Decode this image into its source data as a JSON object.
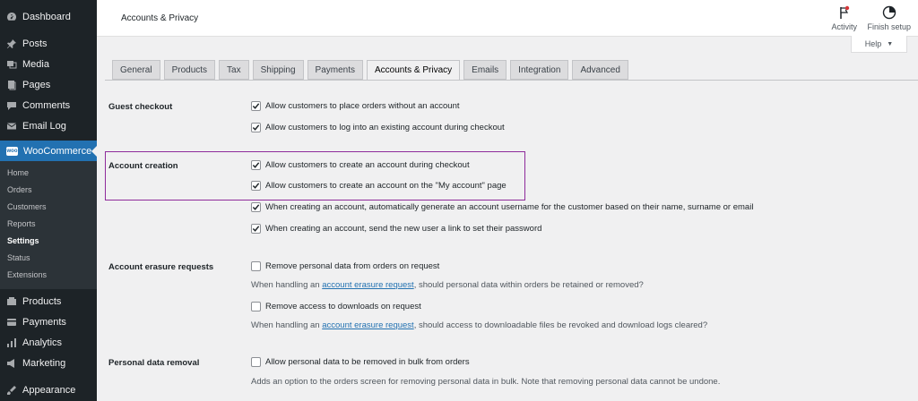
{
  "sidebar": {
    "top_items": [
      {
        "label": "Dashboard",
        "icon": "dashboard-icon"
      },
      {
        "label": "Posts",
        "icon": "pin-icon"
      },
      {
        "label": "Media",
        "icon": "media-icon"
      },
      {
        "label": "Pages",
        "icon": "pages-icon"
      },
      {
        "label": "Comments",
        "icon": "comments-icon"
      },
      {
        "label": "Email Log",
        "icon": "email-icon"
      }
    ],
    "woocommerce_label": "WooCommerce",
    "woocommerce_icon_text": "woo",
    "sub_items": [
      "Home",
      "Orders",
      "Customers",
      "Reports",
      "Settings",
      "Status",
      "Extensions"
    ],
    "bottom_items": [
      {
        "label": "Products",
        "icon": "products-icon"
      },
      {
        "label": "Payments",
        "icon": "payments-icon"
      },
      {
        "label": "Analytics",
        "icon": "analytics-icon"
      },
      {
        "label": "Marketing",
        "icon": "marketing-icon"
      },
      {
        "label": "Appearance",
        "icon": "appearance-icon"
      }
    ]
  },
  "header": {
    "title": "Accounts & Privacy",
    "activity_label": "Activity",
    "finish_setup_label": "Finish setup",
    "help_label": "Help"
  },
  "tabs": [
    "General",
    "Products",
    "Tax",
    "Shipping",
    "Payments",
    "Accounts & Privacy",
    "Emails",
    "Integration",
    "Advanced"
  ],
  "form": {
    "guest_checkout": {
      "label": "Guest checkout",
      "options": [
        "Allow customers to place orders without an account",
        "Allow customers to log into an existing account during checkout"
      ]
    },
    "account_creation": {
      "label": "Account creation",
      "options": [
        "Allow customers to create an account during checkout",
        "Allow customers to create an account on the \"My account\" page",
        "When creating an account, automatically generate an account username for the customer based on their name, surname or email",
        "When creating an account, send the new user a link to set their password"
      ]
    },
    "erasure": {
      "label": "Account erasure requests",
      "option1": "Remove personal data from orders on request",
      "desc1_pre": "When handling an ",
      "desc1_link": "account erasure request",
      "desc1_post": ", should personal data within orders be retained or removed?",
      "option2": "Remove access to downloads on request",
      "desc2_pre": "When handling an ",
      "desc2_link": "account erasure request",
      "desc2_post": ", should access to downloadable files be revoked and download logs cleared?"
    },
    "removal": {
      "label": "Personal data removal",
      "option": "Allow personal data to be removed in bulk from orders",
      "desc": "Adds an option to the orders screen for removing personal data in bulk. Note that removing personal data cannot be undone."
    }
  },
  "colors": {
    "sidebar_bg": "#1d2327",
    "accent": "#2271b1",
    "highlight_border": "#8e2b9b",
    "notification_dot": "#d63638"
  }
}
